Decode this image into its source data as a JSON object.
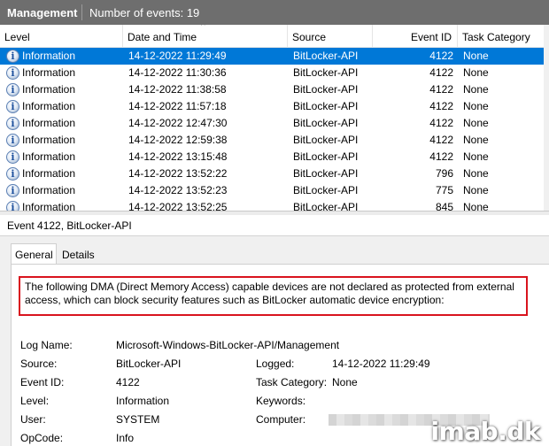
{
  "header": {
    "log_name": "Management",
    "event_count": "Number of events: 19"
  },
  "columns": {
    "level": "Level",
    "date_time": "Date and Time",
    "source": "Source",
    "event_id": "Event ID",
    "task_category": "Task Category"
  },
  "events": [
    {
      "level": "Information",
      "date_time": "14-12-2022 11:29:49",
      "source": "BitLocker-API",
      "event_id": "4122",
      "task_category": "None",
      "selected": true
    },
    {
      "level": "Information",
      "date_time": "14-12-2022 11:30:36",
      "source": "BitLocker-API",
      "event_id": "4122",
      "task_category": "None"
    },
    {
      "level": "Information",
      "date_time": "14-12-2022 11:38:58",
      "source": "BitLocker-API",
      "event_id": "4122",
      "task_category": "None"
    },
    {
      "level": "Information",
      "date_time": "14-12-2022 11:57:18",
      "source": "BitLocker-API",
      "event_id": "4122",
      "task_category": "None"
    },
    {
      "level": "Information",
      "date_time": "14-12-2022 12:47:30",
      "source": "BitLocker-API",
      "event_id": "4122",
      "task_category": "None"
    },
    {
      "level": "Information",
      "date_time": "14-12-2022 12:59:38",
      "source": "BitLocker-API",
      "event_id": "4122",
      "task_category": "None"
    },
    {
      "level": "Information",
      "date_time": "14-12-2022 13:15:48",
      "source": "BitLocker-API",
      "event_id": "4122",
      "task_category": "None"
    },
    {
      "level": "Information",
      "date_time": "14-12-2022 13:52:22",
      "source": "BitLocker-API",
      "event_id": "796",
      "task_category": "None"
    },
    {
      "level": "Information",
      "date_time": "14-12-2022 13:52:23",
      "source": "BitLocker-API",
      "event_id": "775",
      "task_category": "None"
    },
    {
      "level": "Information",
      "date_time": "14-12-2022 13:52:25",
      "source": "BitLocker-API",
      "event_id": "845",
      "task_category": "None"
    }
  ],
  "details": {
    "title": "Event 4122, BitLocker-API",
    "tabs": {
      "general": "General",
      "details": "Details"
    },
    "message": "The following DMA (Direct Memory Access) capable devices are not declared as protected from external access, which can block security features such as BitLocker automatic device encryption:",
    "labels": {
      "log_name": "Log Name:",
      "source": "Source:",
      "event_id": "Event ID:",
      "level": "Level:",
      "user": "User:",
      "opcode": "OpCode:",
      "logged": "Logged:",
      "task_category": "Task Category:",
      "keywords": "Keywords:",
      "computer": "Computer:"
    },
    "values": {
      "log_name": "Microsoft-Windows-BitLocker-API/Management",
      "source": "BitLocker-API",
      "event_id": "4122",
      "level": "Information",
      "user": "SYSTEM",
      "opcode": "Info",
      "logged": "14-12-2022 11:29:49",
      "task_category": "None",
      "keywords": ""
    }
  },
  "watermark": "imab.dk",
  "colors": {
    "titlebar": "#6e6e6e",
    "selection": "#0078d7",
    "highlight_box": "#d9141e"
  }
}
